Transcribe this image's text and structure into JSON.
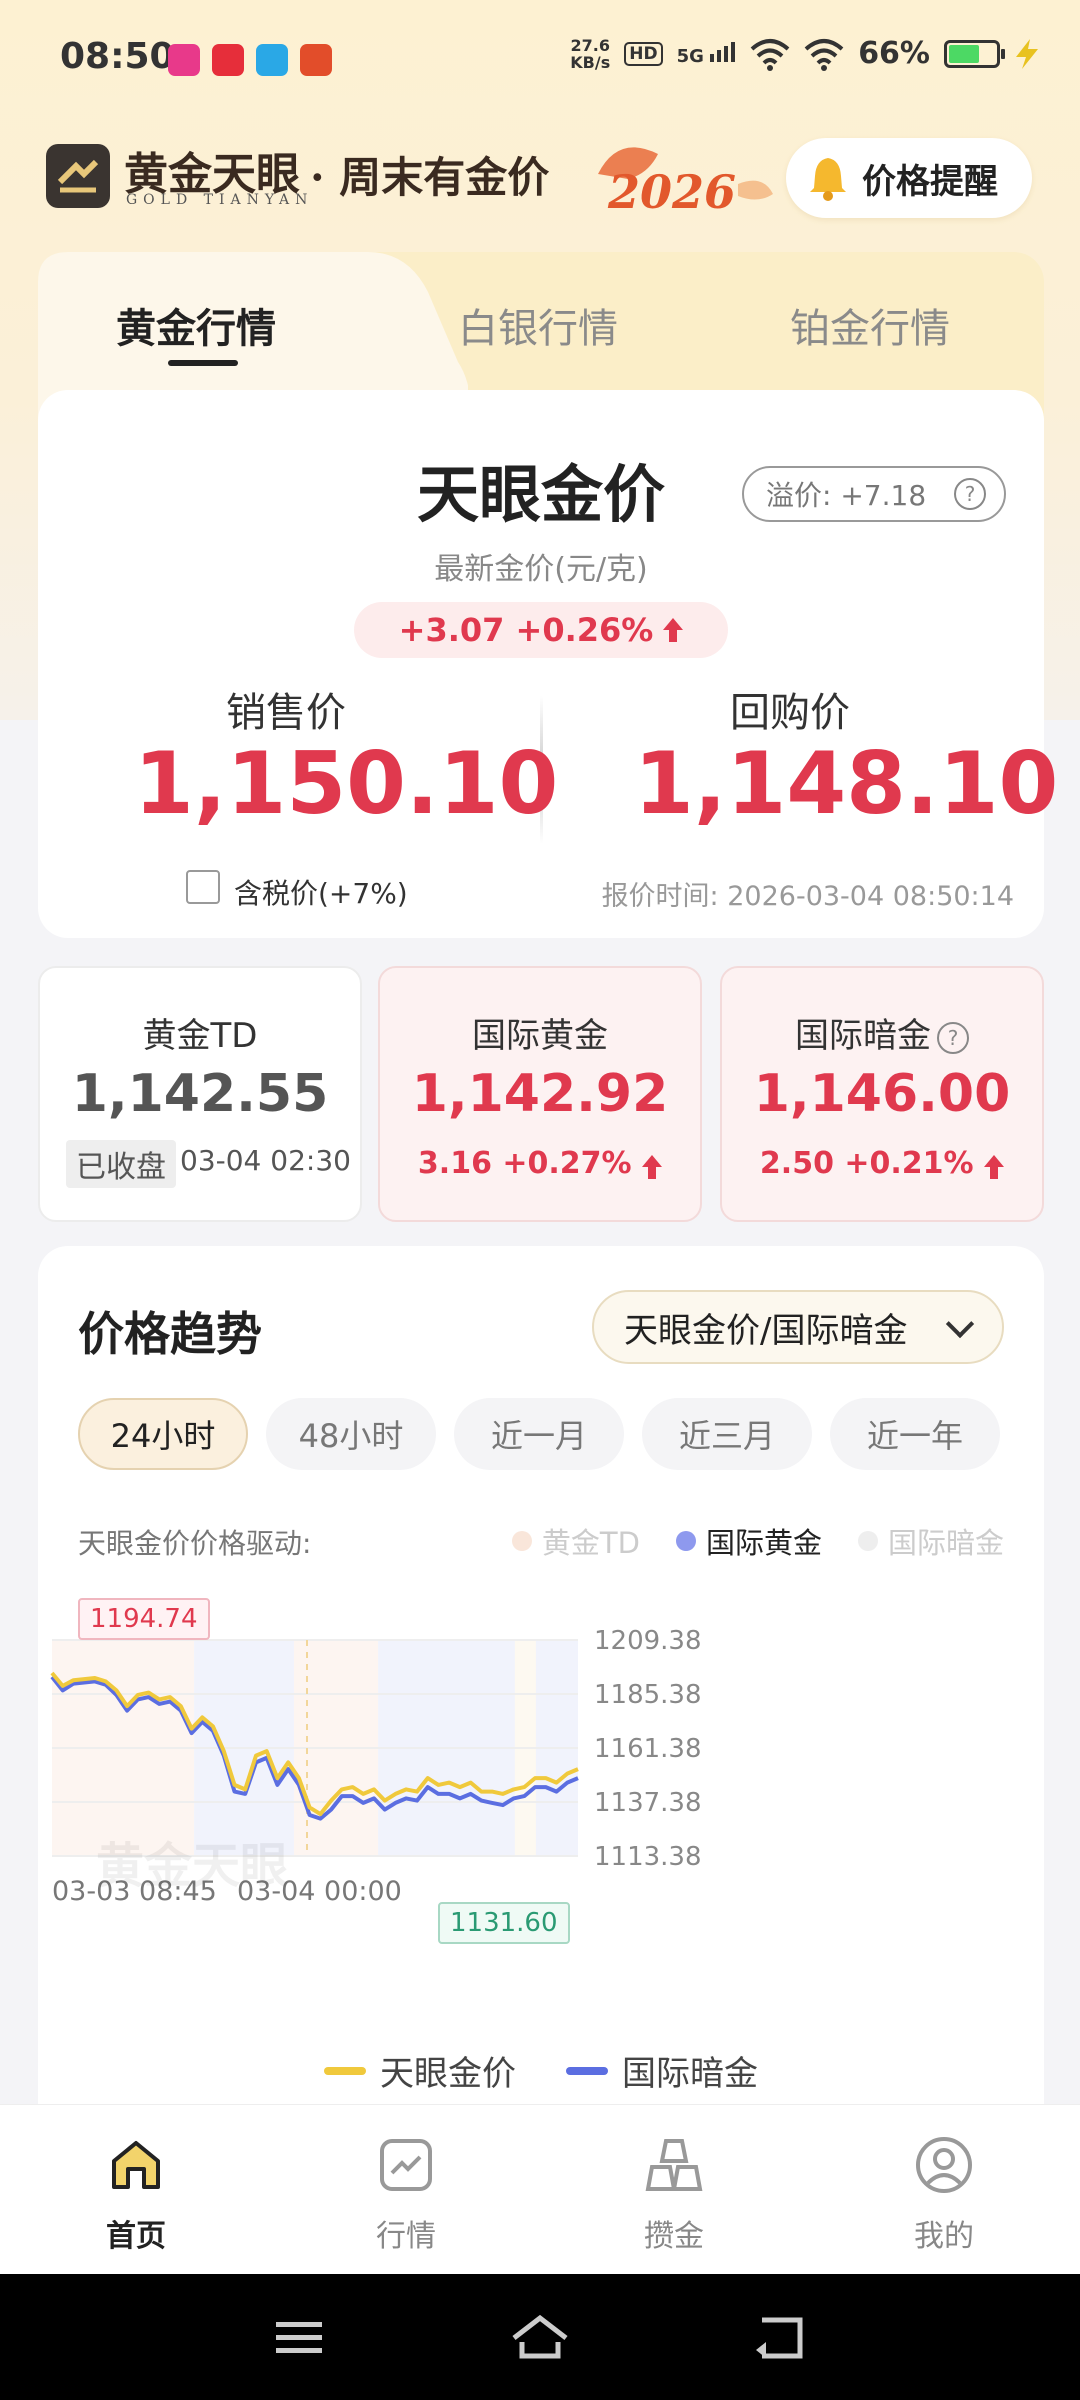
{
  "status_bar": {
    "time": "08:50",
    "net_speed_value": "27.6",
    "net_speed_unit": "KB/s",
    "hd": "HD",
    "network": "5G",
    "battery_pct": "66%"
  },
  "header": {
    "brand_cn": "黄金天眼",
    "brand_en": "GOLD TIANYAN",
    "slogan": "· 周末有金价",
    "year_art": "2026",
    "alert_button": "价格提醒"
  },
  "metal_tabs": [
    "黄金行情",
    "白银行情",
    "铂金行情"
  ],
  "price_panel": {
    "title": "天眼金价",
    "subtitle": "最新金价(元/克)",
    "premium": "溢价: +7.18",
    "premium_help": "?",
    "change": "+3.07 +0.26%",
    "sell_label": "销售价",
    "sell_price": "1,150.10",
    "buy_label": "回购价",
    "buy_price": "1,148.10",
    "tax_label": "含税价(+7%)",
    "quote_time": "报价时间: 2026-03-04 08:50:14"
  },
  "mini_cards": {
    "td": {
      "title": "黄金TD",
      "value": "1,142.55",
      "status": "已收盘",
      "time": "03-04 02:30"
    },
    "intl": {
      "title": "国际黄金",
      "value": "1,142.92",
      "change": "3.16 +0.27%"
    },
    "dark": {
      "title": "国际暗金",
      "value": "1,146.00",
      "change": "2.50 +0.21%"
    }
  },
  "trend": {
    "title": "价格趋势",
    "selector": "天眼金价/国际暗金",
    "ranges": [
      "24小时",
      "48小时",
      "近一月",
      "近三月",
      "近一年"
    ],
    "driver_label": "天眼金价价格驱动:",
    "drivers": [
      "黄金TD",
      "国际黄金",
      "国际暗金"
    ],
    "max_label": "1194.74",
    "min_label": "1131.60",
    "watermark": "黄金天眼",
    "legend": [
      "天眼金价",
      "国际暗金"
    ]
  },
  "chart_data": {
    "type": "line",
    "x_labels": [
      "03-03 08:45",
      "03-04 00:00"
    ],
    "yticks": [
      "1209.38",
      "1185.38",
      "1161.38",
      "1137.38",
      "1113.38"
    ],
    "ylim": [
      1113.38,
      1209.38
    ],
    "grid": true,
    "legend_position": "bottom",
    "series": [
      {
        "name": "天眼金价",
        "color": "#f0c93c",
        "values": [
          1194.7,
          1189,
          1191.5,
          1192,
          1192.5,
          1191,
          1187,
          1180,
          1185,
          1186,
          1183,
          1184,
          1180,
          1170,
          1175,
          1171,
          1160,
          1145,
          1143,
          1158,
          1160,
          1148,
          1155,
          1148,
          1135,
          1132,
          1138,
          1143,
          1144,
          1141,
          1143,
          1138,
          1141,
          1143,
          1142,
          1148,
          1145,
          1146,
          1144,
          1146,
          1142,
          1142,
          1141,
          1143,
          1144,
          1148,
          1148,
          1146,
          1150,
          1152
        ]
      },
      {
        "name": "国际暗金",
        "color": "#5b6ee1",
        "values": [
          1193,
          1187,
          1190,
          1190.5,
          1191,
          1189.5,
          1185,
          1178,
          1183,
          1184,
          1181,
          1182,
          1178,
          1168,
          1173,
          1169,
          1158,
          1142,
          1141,
          1155,
          1157,
          1145,
          1152,
          1145,
          1131.6,
          1130,
          1134,
          1140,
          1140,
          1137,
          1139,
          1134,
          1137,
          1139,
          1138,
          1144,
          1141,
          1141,
          1139,
          1141,
          1138,
          1137,
          1136,
          1139,
          1140,
          1144,
          1144,
          1142,
          1146,
          1148
        ]
      }
    ]
  },
  "bottom_nav": [
    "首页",
    "行情",
    "攒金",
    "我的"
  ],
  "colors": {
    "up_red": "#e0394e",
    "gold_line": "#f0c93c",
    "blue_line": "#5b6ee1",
    "td_dot": "#f6d9c6",
    "intl_dot": "#6f7de8",
    "dark_dot": "#dddddd"
  }
}
